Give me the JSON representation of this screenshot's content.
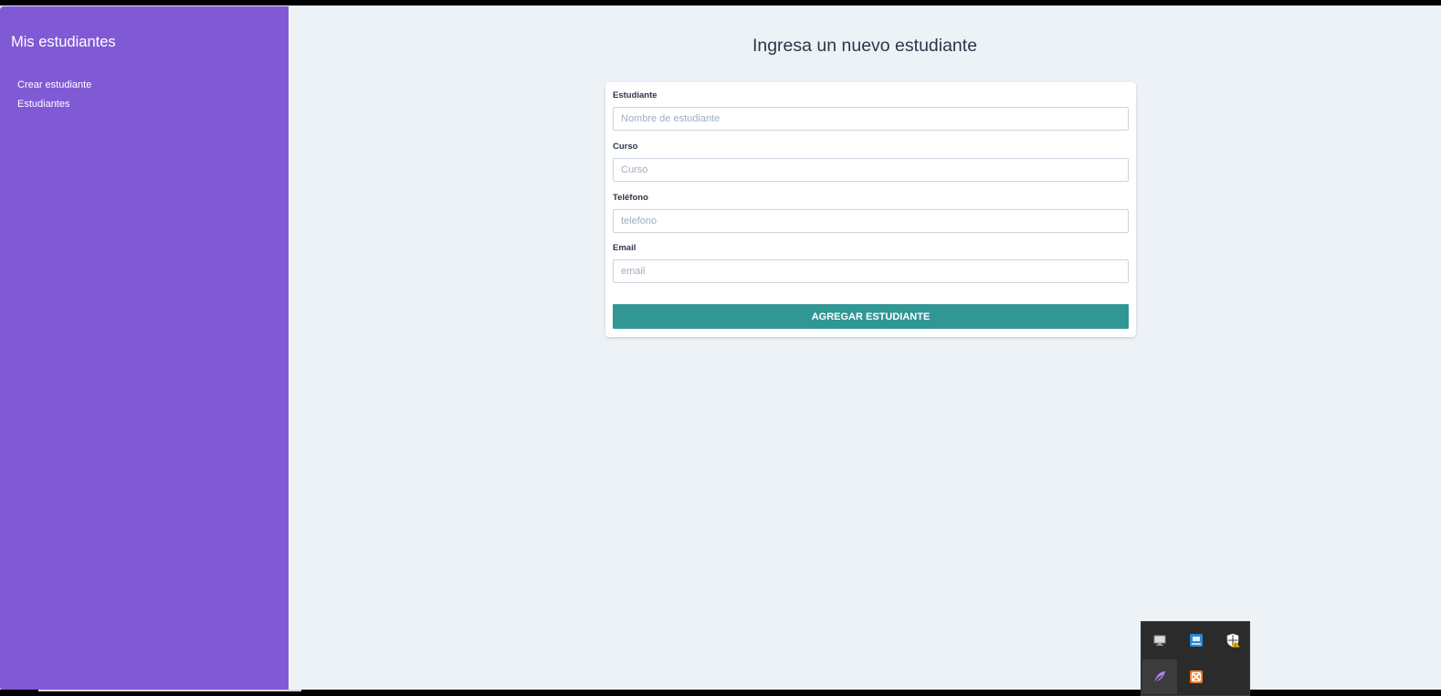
{
  "sidebar": {
    "title": "Mis estudiantes",
    "items": [
      {
        "label": "Crear estudiante"
      },
      {
        "label": "Estudiantes"
      }
    ]
  },
  "main": {
    "title": "Ingresa un nuevo estudiante",
    "form": {
      "fields": [
        {
          "label": "Estudiante",
          "placeholder": "Nombre de estudiante",
          "value": ""
        },
        {
          "label": "Curso",
          "placeholder": "Curso",
          "value": ""
        },
        {
          "label": "Teléfono",
          "placeholder": "telefono",
          "value": ""
        },
        {
          "label": "Email",
          "placeholder": "email",
          "value": ""
        }
      ],
      "submit_label": "AGREGAR ESTUDIANTE"
    }
  },
  "tray": {
    "icons": [
      {
        "name": "display-icon"
      },
      {
        "name": "network-app-icon"
      },
      {
        "name": "security-warning-icon"
      },
      {
        "name": "feather-app-icon"
      },
      {
        "name": "xampp-icon"
      }
    ]
  },
  "colors": {
    "sidebar": "#805ad5",
    "background": "#edf2f7",
    "button": "#319795",
    "text": "#2d3748",
    "placeholder": "#a0aec0"
  }
}
